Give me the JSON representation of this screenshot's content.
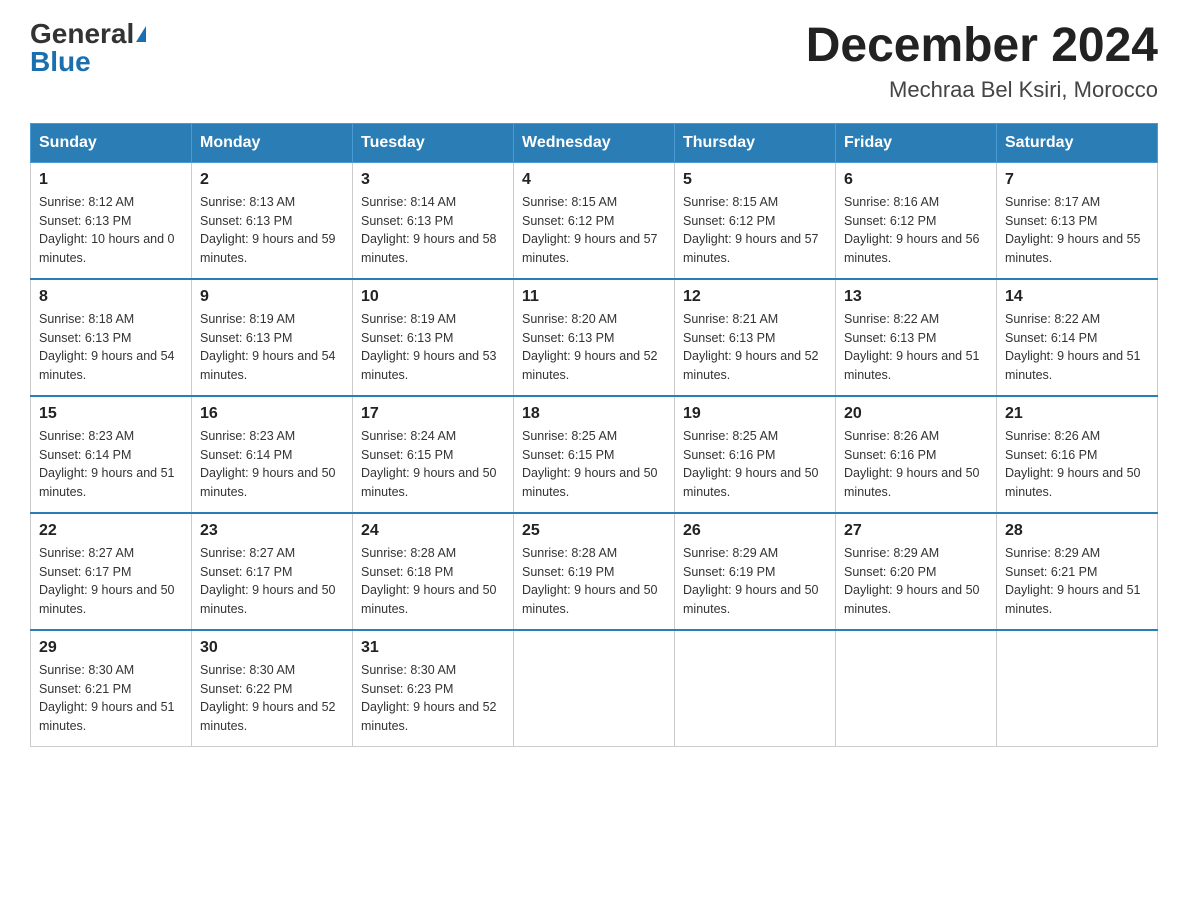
{
  "header": {
    "logo_general": "General",
    "logo_blue": "Blue",
    "month_year": "December 2024",
    "location": "Mechraa Bel Ksiri, Morocco"
  },
  "days_of_week": [
    "Sunday",
    "Monday",
    "Tuesday",
    "Wednesday",
    "Thursday",
    "Friday",
    "Saturday"
  ],
  "weeks": [
    [
      {
        "day": "1",
        "sunrise": "8:12 AM",
        "sunset": "6:13 PM",
        "daylight": "10 hours and 0 minutes."
      },
      {
        "day": "2",
        "sunrise": "8:13 AM",
        "sunset": "6:13 PM",
        "daylight": "9 hours and 59 minutes."
      },
      {
        "day": "3",
        "sunrise": "8:14 AM",
        "sunset": "6:13 PM",
        "daylight": "9 hours and 58 minutes."
      },
      {
        "day": "4",
        "sunrise": "8:15 AM",
        "sunset": "6:12 PM",
        "daylight": "9 hours and 57 minutes."
      },
      {
        "day": "5",
        "sunrise": "8:15 AM",
        "sunset": "6:12 PM",
        "daylight": "9 hours and 57 minutes."
      },
      {
        "day": "6",
        "sunrise": "8:16 AM",
        "sunset": "6:12 PM",
        "daylight": "9 hours and 56 minutes."
      },
      {
        "day": "7",
        "sunrise": "8:17 AM",
        "sunset": "6:13 PM",
        "daylight": "9 hours and 55 minutes."
      }
    ],
    [
      {
        "day": "8",
        "sunrise": "8:18 AM",
        "sunset": "6:13 PM",
        "daylight": "9 hours and 54 minutes."
      },
      {
        "day": "9",
        "sunrise": "8:19 AM",
        "sunset": "6:13 PM",
        "daylight": "9 hours and 54 minutes."
      },
      {
        "day": "10",
        "sunrise": "8:19 AM",
        "sunset": "6:13 PM",
        "daylight": "9 hours and 53 minutes."
      },
      {
        "day": "11",
        "sunrise": "8:20 AM",
        "sunset": "6:13 PM",
        "daylight": "9 hours and 52 minutes."
      },
      {
        "day": "12",
        "sunrise": "8:21 AM",
        "sunset": "6:13 PM",
        "daylight": "9 hours and 52 minutes."
      },
      {
        "day": "13",
        "sunrise": "8:22 AM",
        "sunset": "6:13 PM",
        "daylight": "9 hours and 51 minutes."
      },
      {
        "day": "14",
        "sunrise": "8:22 AM",
        "sunset": "6:14 PM",
        "daylight": "9 hours and 51 minutes."
      }
    ],
    [
      {
        "day": "15",
        "sunrise": "8:23 AM",
        "sunset": "6:14 PM",
        "daylight": "9 hours and 51 minutes."
      },
      {
        "day": "16",
        "sunrise": "8:23 AM",
        "sunset": "6:14 PM",
        "daylight": "9 hours and 50 minutes."
      },
      {
        "day": "17",
        "sunrise": "8:24 AM",
        "sunset": "6:15 PM",
        "daylight": "9 hours and 50 minutes."
      },
      {
        "day": "18",
        "sunrise": "8:25 AM",
        "sunset": "6:15 PM",
        "daylight": "9 hours and 50 minutes."
      },
      {
        "day": "19",
        "sunrise": "8:25 AM",
        "sunset": "6:16 PM",
        "daylight": "9 hours and 50 minutes."
      },
      {
        "day": "20",
        "sunrise": "8:26 AM",
        "sunset": "6:16 PM",
        "daylight": "9 hours and 50 minutes."
      },
      {
        "day": "21",
        "sunrise": "8:26 AM",
        "sunset": "6:16 PM",
        "daylight": "9 hours and 50 minutes."
      }
    ],
    [
      {
        "day": "22",
        "sunrise": "8:27 AM",
        "sunset": "6:17 PM",
        "daylight": "9 hours and 50 minutes."
      },
      {
        "day": "23",
        "sunrise": "8:27 AM",
        "sunset": "6:17 PM",
        "daylight": "9 hours and 50 minutes."
      },
      {
        "day": "24",
        "sunrise": "8:28 AM",
        "sunset": "6:18 PM",
        "daylight": "9 hours and 50 minutes."
      },
      {
        "day": "25",
        "sunrise": "8:28 AM",
        "sunset": "6:19 PM",
        "daylight": "9 hours and 50 minutes."
      },
      {
        "day": "26",
        "sunrise": "8:29 AM",
        "sunset": "6:19 PM",
        "daylight": "9 hours and 50 minutes."
      },
      {
        "day": "27",
        "sunrise": "8:29 AM",
        "sunset": "6:20 PM",
        "daylight": "9 hours and 50 minutes."
      },
      {
        "day": "28",
        "sunrise": "8:29 AM",
        "sunset": "6:21 PM",
        "daylight": "9 hours and 51 minutes."
      }
    ],
    [
      {
        "day": "29",
        "sunrise": "8:30 AM",
        "sunset": "6:21 PM",
        "daylight": "9 hours and 51 minutes."
      },
      {
        "day": "30",
        "sunrise": "8:30 AM",
        "sunset": "6:22 PM",
        "daylight": "9 hours and 52 minutes."
      },
      {
        "day": "31",
        "sunrise": "8:30 AM",
        "sunset": "6:23 PM",
        "daylight": "9 hours and 52 minutes."
      },
      null,
      null,
      null,
      null
    ]
  ]
}
